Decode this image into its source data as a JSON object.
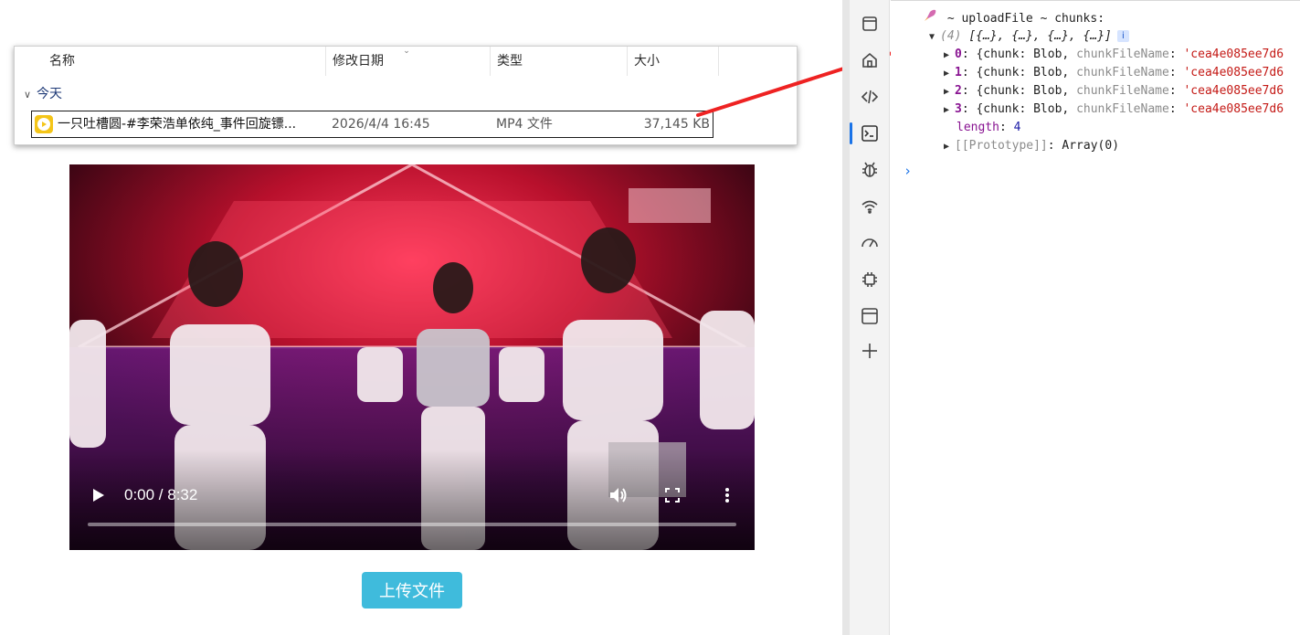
{
  "explorer": {
    "columns": [
      "名称",
      "修改日期",
      "类型",
      "大小"
    ],
    "group_label": "今天",
    "file": {
      "name": "一只吐槽圆-#李荣浩单依纯_事件回旋镖...",
      "modified": "2026/4/4 16:45",
      "type": "MP4 文件",
      "size": "37,145 KB"
    }
  },
  "video": {
    "time": "0:00 / 8:32",
    "progress_fraction": 0.0,
    "icons": [
      "play-icon",
      "volume-icon",
      "fullscreen-icon",
      "more-options-icon"
    ]
  },
  "upload_button": {
    "label": "上传文件"
  },
  "accent_colors": {
    "upload_button": "#3fbbdc",
    "arrow": "#ee2222",
    "file_icon": "#f4c518"
  },
  "devtools": {
    "activity_icons": [
      "welcome-icon",
      "elements-icon",
      "console-icon",
      "sources-icon",
      "network-icon",
      "performance-icon",
      "memory-icon",
      "application-icon",
      "add-tool-icon"
    ],
    "console": {
      "log_label": "~ uploadFile ~ chunks:",
      "array_count": "(4)",
      "array_preview": "[{…}, {…}, {…}, {…}]",
      "info_badge": "i",
      "entries": [
        {
          "index": "0",
          "text": "{chunk: Blob, ",
          "prop": "chunkFileName",
          "value": "'cea4e085ee7d6"
        },
        {
          "index": "1",
          "text": "{chunk: Blob, ",
          "prop": "chunkFileName",
          "value": "'cea4e085ee7d6"
        },
        {
          "index": "2",
          "text": "{chunk: Blob, ",
          "prop": "chunkFileName",
          "value": "'cea4e085ee7d6"
        },
        {
          "index": "3",
          "text": "{chunk: Blob, ",
          "prop": "chunkFileName",
          "value": "'cea4e085ee7d6"
        }
      ],
      "length_key": "length",
      "length_value": "4",
      "prototype_key": "[[Prototype]]",
      "prototype_value": "Array(0)",
      "prompt": "›"
    }
  }
}
